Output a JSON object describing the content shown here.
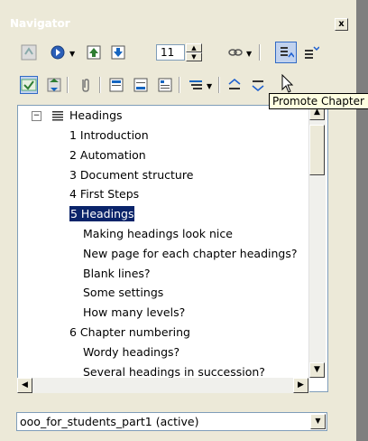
{
  "window": {
    "title": "Navigator",
    "close_label": "x"
  },
  "toolbar1": {
    "spin_value": "11"
  },
  "tooltip": {
    "text": "Promote Chapter"
  },
  "tree": {
    "root_label": "Headings",
    "expander": "−",
    "items": [
      {
        "label": "1 Introduction"
      },
      {
        "label": "2 Automation"
      },
      {
        "label": "3 Document structure"
      },
      {
        "label": "4 First Steps"
      },
      {
        "label": "5 Headings",
        "selected": true
      },
      {
        "label": "Making headings look nice"
      },
      {
        "label": "New page for each chapter headings?"
      },
      {
        "label": "Blank lines?"
      },
      {
        "label": "Some settings"
      },
      {
        "label": "How many levels?"
      },
      {
        "label": "6 Chapter numbering"
      },
      {
        "label": "Wordy headings?"
      },
      {
        "label": "Several headings in succession?"
      }
    ]
  },
  "document_select": {
    "value": "ooo_for_students_part1 (active)"
  },
  "icons": {
    "toolbar1": [
      "navigation-toggle-icon",
      "navigation-circle-icon",
      "dropdown-arrow-icon",
      "previous-object-icon",
      "next-object-icon",
      "link-icon",
      "dropdown-arrow-icon",
      "promote-level-icon",
      "demote-level-icon"
    ],
    "toolbar2": [
      "list-box-toggle-icon",
      "content-view-icon",
      "reminder-icon",
      "header-icon",
      "footer-icon",
      "anchor-icon",
      "heading-levels-icon",
      "dropdown-arrow-icon",
      "promote-chapter-icon",
      "demote-chapter-icon"
    ]
  }
}
